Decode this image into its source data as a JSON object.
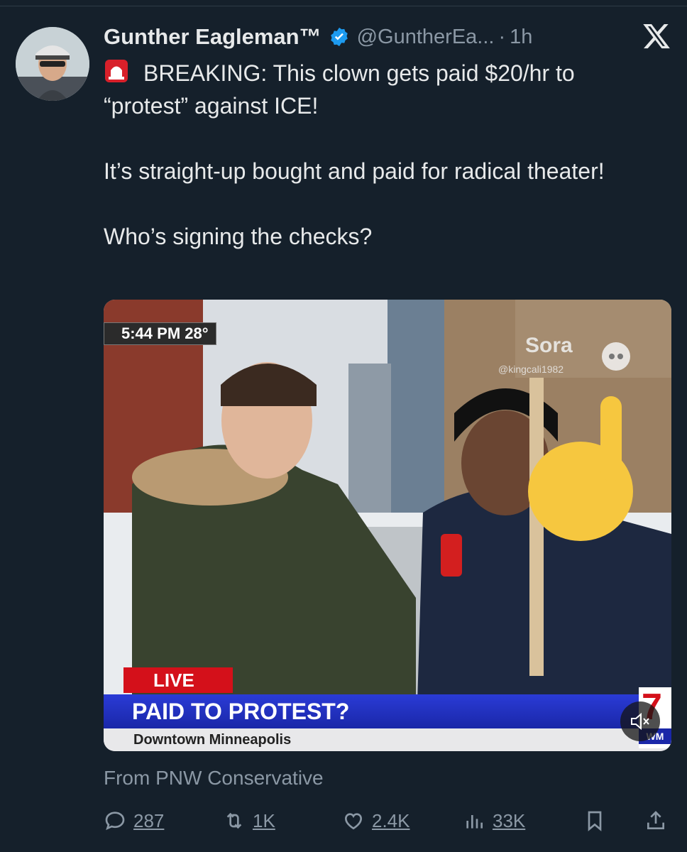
{
  "tweet": {
    "author_name": "Gunther Eagleman™",
    "author_handle": "@GuntherEa...",
    "separator": "·",
    "time": "1h",
    "verified_color": "#1d9bf0",
    "text_line1": "BREAKING: This clown gets paid $20/hr to “protest” against ICE!",
    "text_line2": "It’s straight-up bought and paid for radical theater!",
    "text_line3": "Who’s signing the checks?",
    "source": "From PNW Conservative"
  },
  "media": {
    "timestamp": "5:44 PM  28°",
    "watermark": "Sora",
    "watermark_handle": "@kingcali1982",
    "live_label": "LIVE",
    "headline": "PAID TO PROTEST?",
    "location": "Downtown Minneapolis",
    "station_number": "7",
    "station_call": "WM",
    "icons": [
      "sora-cloud-icon",
      "pointing-up-emoji",
      "speaker-muted-icon"
    ]
  },
  "actions": {
    "replies": "287",
    "reposts": "1K",
    "likes": "2.4K",
    "views": "33K"
  },
  "icons": [
    "siren-emoji",
    "verified-badge-icon",
    "x-logo-icon",
    "reply-icon",
    "repost-icon",
    "like-icon",
    "views-icon",
    "bookmark-icon",
    "share-icon"
  ]
}
